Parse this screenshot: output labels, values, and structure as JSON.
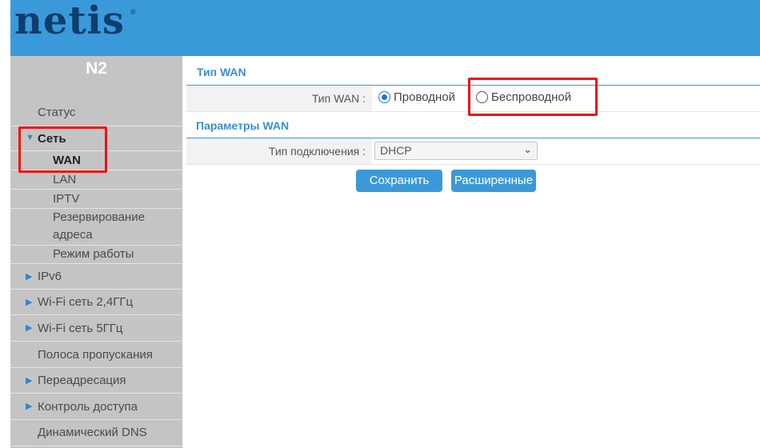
{
  "header": {
    "logo_text": "netis",
    "logo_mark": "®",
    "model": "N2",
    "bg_color": "#3a9ad9"
  },
  "sidebar": {
    "items": [
      {
        "label": "Статус",
        "arrow": "",
        "icon": ""
      },
      {
        "label": "Сеть",
        "arrow": "▼",
        "icon": "triangle-down-icon",
        "expanded": true
      },
      {
        "label": "WAN",
        "sub": true,
        "selected": true
      },
      {
        "label": "LAN",
        "sub": true
      },
      {
        "label": "IPTV",
        "sub": true
      },
      {
        "label": "Резервирование",
        "sub": true
      },
      {
        "label": "адреса",
        "sub": true
      },
      {
        "label": "Режим работы",
        "sub": true
      },
      {
        "label": "IPv6",
        "arrow": "▶",
        "icon": "triangle-right-icon"
      },
      {
        "label": "Wi-Fi сеть 2,4ГГц",
        "arrow": "▶",
        "icon": "triangle-right-icon"
      },
      {
        "label": "Wi-Fi сеть 5ГГц",
        "arrow": "▶",
        "icon": "triangle-right-icon"
      },
      {
        "label": "Полоса пропускания",
        "arrow": ""
      },
      {
        "label": "Переадресация",
        "arrow": "▶",
        "icon": "triangle-right-icon"
      },
      {
        "label": "Контроль доступа",
        "arrow": "▶",
        "icon": "triangle-right-icon"
      },
      {
        "label": "Динамический DNS",
        "arrow": ""
      }
    ]
  },
  "wan_type": {
    "section_title": "Тип WAN",
    "label": "Тип WAN :",
    "options": [
      {
        "label": "Проводной",
        "checked": true
      },
      {
        "label": "Беспроводной",
        "checked": false
      }
    ]
  },
  "wan_params": {
    "section_title": "Параметры WAN",
    "connection_label": "Тип подключения :",
    "connection_value": "DHCP"
  },
  "buttons": {
    "save": "Сохранить",
    "advanced": "Расширенные"
  },
  "colors": {
    "accent": "#3a9ad9",
    "highlight": "#ee1111",
    "sidebar": "#c4c4c4"
  }
}
